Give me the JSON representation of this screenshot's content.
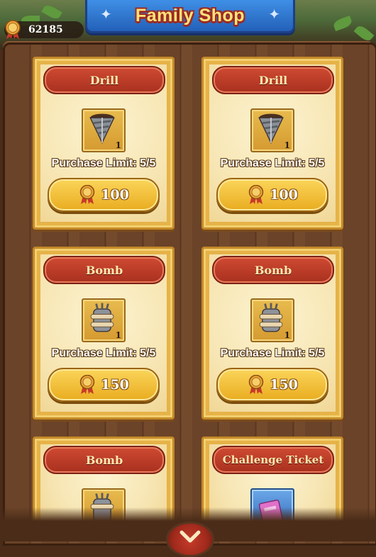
{
  "header": {
    "title": "Family Shop",
    "currency_value": "62185"
  },
  "shop": {
    "limit_prefix": "Purchase Limit: ",
    "items": [
      {
        "name": "Drill",
        "icon": "drill-icon",
        "count": "1",
        "limit": "Purchase Limit: 5/5",
        "price": "100"
      },
      {
        "name": "Drill",
        "icon": "drill-icon",
        "count": "1",
        "limit": "Purchase Limit: 5/5",
        "price": "100"
      },
      {
        "name": "Bomb",
        "icon": "bomb-icon",
        "count": "1",
        "limit": "Purchase Limit: 5/5",
        "price": "150"
      },
      {
        "name": "Bomb",
        "icon": "bomb-icon",
        "count": "1",
        "limit": "Purchase Limit: 5/5",
        "price": "150"
      },
      {
        "name": "Bomb",
        "icon": "bomb-icon",
        "count": "",
        "limit": "",
        "price": ""
      },
      {
        "name": "Challenge Ticket",
        "icon": "ticket-icon",
        "count": "",
        "limit": "",
        "price": ""
      }
    ]
  },
  "colors": {
    "banner": "#2f78d4",
    "tag": "#bf3e28",
    "button": "#f2c23c",
    "card": "#e6b348"
  }
}
